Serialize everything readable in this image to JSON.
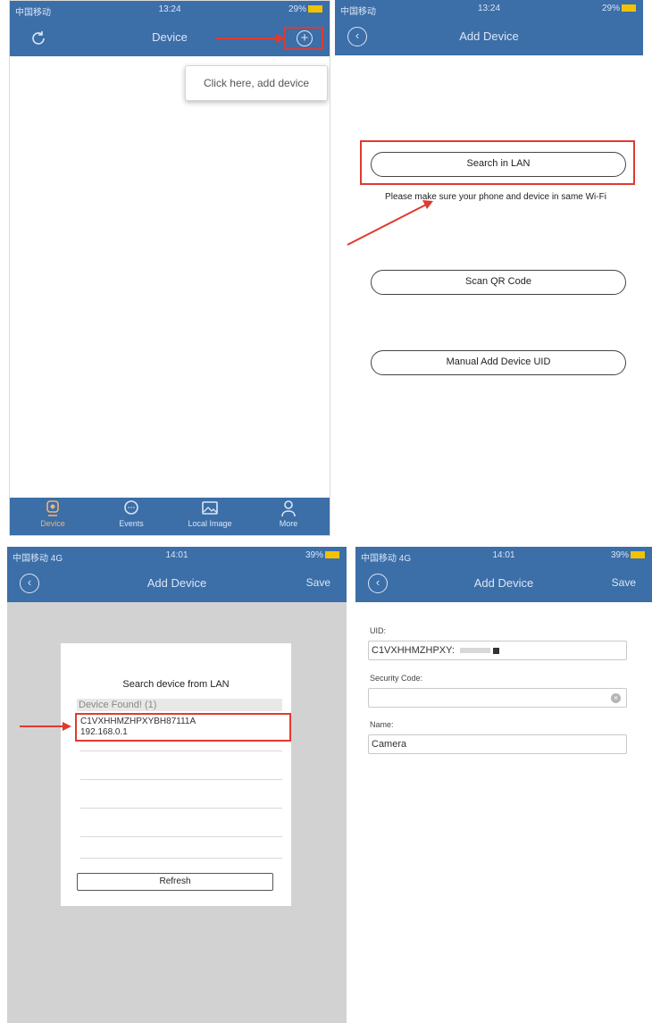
{
  "colors": {
    "nav_blue": "#3c6ea8",
    "highlight_red": "#e03a2e",
    "tab_active": "#f0b27a",
    "overlay_gray": "#d2d2d2"
  },
  "screen1": {
    "status": {
      "carrier": "中国移动",
      "time": "13:24",
      "battery": "29%"
    },
    "title": "Device",
    "left_icon": "refresh-icon",
    "right_icon": "add-icon",
    "tooltip": "Click here, add device",
    "tabs": [
      {
        "label": "Device",
        "icon": "camera-icon",
        "active": true
      },
      {
        "label": "Events",
        "icon": "message-icon",
        "active": false
      },
      {
        "label": "Local Image",
        "icon": "image-icon",
        "active": false
      },
      {
        "label": "More",
        "icon": "person-icon",
        "active": false
      }
    ]
  },
  "screen2": {
    "status": {
      "carrier": "中国移动",
      "time": "13:24",
      "battery": "29%"
    },
    "title": "Add Device",
    "buttons": {
      "search_lan": "Search in LAN",
      "scan_qr": "Scan QR Code",
      "manual_uid": "Manual Add Device UID"
    },
    "hint": "Please make sure your phone and device in same Wi-Fi"
  },
  "screen3": {
    "status": {
      "carrier": "中国移动",
      "network": "4G",
      "time": "14:01",
      "battery": "39%"
    },
    "title": "Add Device",
    "save": "Save",
    "dialog": {
      "title": "Search device from LAN",
      "found_header": "Device Found! (1)",
      "item_uid": "C1VXHHMZHPXYBH87111A",
      "item_ip": "192.168.0.1",
      "refresh": "Refresh"
    }
  },
  "screen4": {
    "status": {
      "carrier": "中国移动",
      "network": "4G",
      "time": "14:01",
      "battery": "39%"
    },
    "title": "Add Device",
    "save": "Save",
    "form": {
      "uid_label": "UID:",
      "uid_value": "C1VXHHMZHPXY:",
      "security_label": "Security Code:",
      "security_value": "",
      "name_label": "Name:",
      "name_value": "Camera"
    }
  }
}
